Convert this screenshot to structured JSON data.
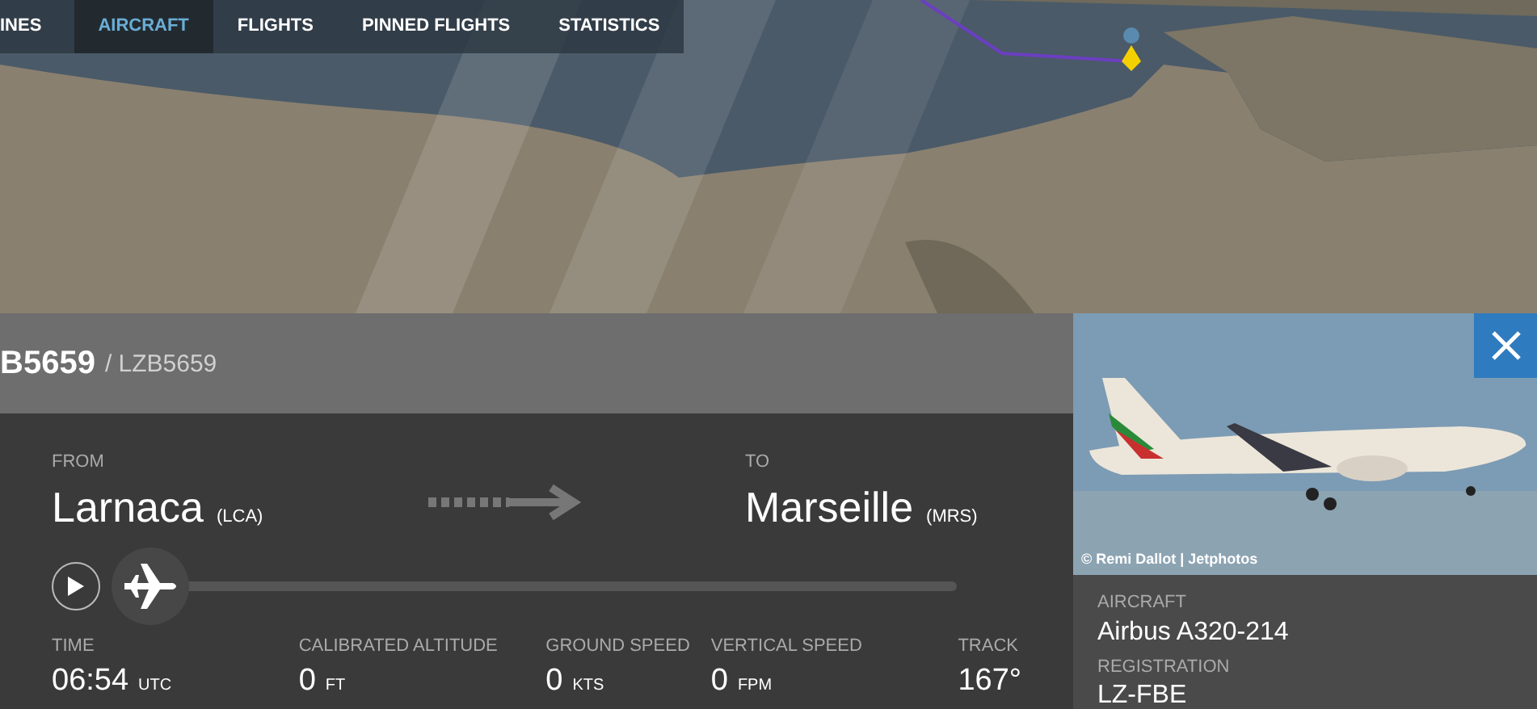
{
  "nav": {
    "tabs": [
      {
        "label": "INES",
        "selected": false
      },
      {
        "label": "AIRCRAFT",
        "selected": true
      },
      {
        "label": "FLIGHTS",
        "selected": false
      },
      {
        "label": "PINNED FLIGHTS",
        "selected": false
      },
      {
        "label": "STATISTICS",
        "selected": false
      }
    ]
  },
  "flight": {
    "callsign": "B5659",
    "alt_callsign": "/ LZB5659",
    "from": {
      "label": "FROM",
      "city": "Larnaca",
      "code": "(LCA)"
    },
    "to": {
      "label": "TO",
      "city": "Marseille",
      "code": "(MRS)"
    },
    "progress": {
      "level": 0.04
    },
    "stats": [
      {
        "label": "TIME",
        "value": "06:54",
        "unit": "UTC"
      },
      {
        "label": "CALIBRATED ALTITUDE",
        "value": "0",
        "unit": "FT"
      },
      {
        "label": "GROUND SPEED",
        "value": "0",
        "unit": "KTS"
      },
      {
        "label": "VERTICAL SPEED",
        "value": "0",
        "unit": "FPM"
      },
      {
        "label": "TRACK",
        "value": "167°"
      }
    ]
  },
  "aircraft_panel": {
    "credit": "© Remi Dallot | Jetphotos",
    "fields": [
      {
        "label": "AIRCRAFT",
        "value": "Airbus A320-214"
      },
      {
        "label": "REGISTRATION",
        "value": "LZ-FBE"
      }
    ]
  }
}
